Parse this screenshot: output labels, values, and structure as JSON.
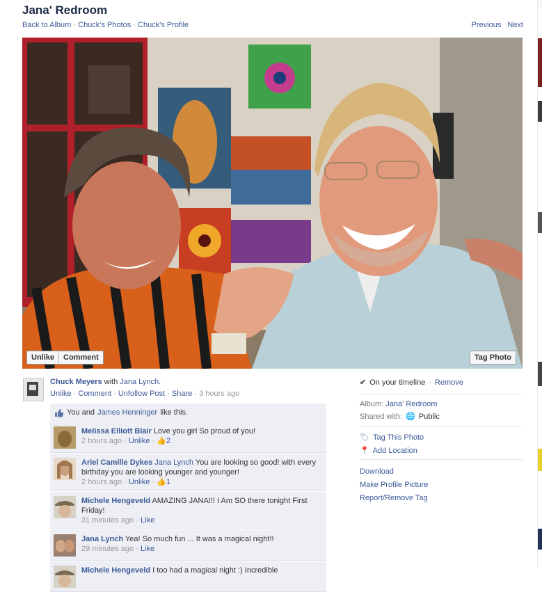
{
  "title": "Jana' Redroom",
  "nav": {
    "back_to_album": "Back to Album",
    "photos": "Chuck's Photos",
    "profile": "Chuck's Profile",
    "previous": "Previous",
    "next": "Next",
    "sep": "·"
  },
  "photo_buttons": {
    "unlike": "Unlike",
    "comment": "Comment",
    "tag_photo": "Tag Photo"
  },
  "post": {
    "author": "Chuck Meyers",
    "with_text": "with",
    "tagged": "Jana Lynch.",
    "actions": [
      "Unlike",
      "Comment",
      "Unfollow Post",
      "Share"
    ],
    "time": "3 hours ago"
  },
  "likes": {
    "you_and": "You and",
    "person": "James Henninger",
    "suffix": "like this."
  },
  "comments": [
    {
      "name": "Melissa Elliott Blair",
      "mention": "",
      "text": "Love you girl So proud of you!",
      "time": "2 hours ago",
      "action": "Unlike",
      "likes": "2"
    },
    {
      "name": "Ariel Camille Dykes",
      "mention": "Jana Lynch",
      "text": "You are looking so good! with every birthday you are looking younger and younger!",
      "time": "2 hours ago",
      "action": "Unlike",
      "likes": "1"
    },
    {
      "name": "Michele Hengeveld",
      "mention": "",
      "text": "AMAZING JANA!!! I Am SO there tonight First Friday!",
      "time": "31 minutes ago",
      "action": "Like",
      "likes": ""
    },
    {
      "name": "Jana Lynch",
      "mention": "",
      "text": "Yea! So much fun ... It was a magical night!!",
      "time": "29 minutes ago",
      "action": "Like",
      "likes": ""
    },
    {
      "name": "Michele Hengeveld",
      "mention": "",
      "text": "I too had a magical night :) Incredible",
      "time": "",
      "action": "",
      "likes": ""
    }
  ],
  "sidebar": {
    "timeline": "On your timeline",
    "remove": "Remove",
    "album_label": "Album:",
    "album_name": "Jana' Redroom",
    "shared_label": "Shared with:",
    "shared_value": "Public",
    "tag_this_photo": "Tag This Photo",
    "add_location": "Add Location",
    "download": "Download",
    "make_profile": "Make Profile Picture",
    "report": "Report/Remove Tag"
  },
  "colors": {
    "link": "#3b5998",
    "comment_bg": "#edeff4"
  }
}
